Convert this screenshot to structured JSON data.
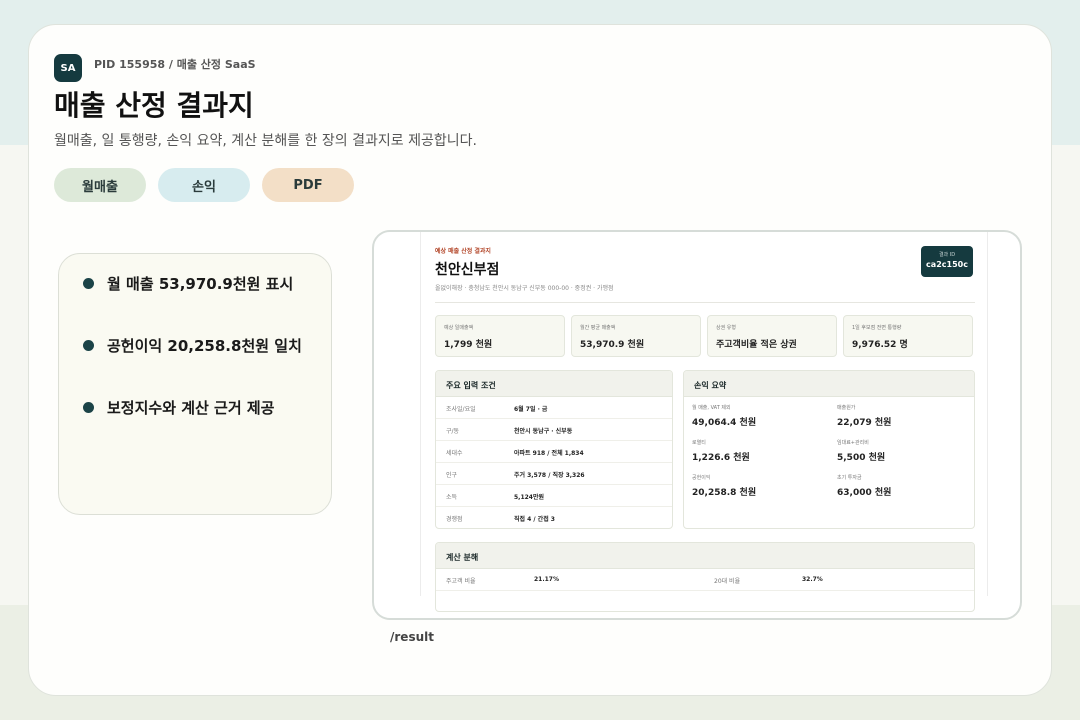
{
  "header": {
    "badge": "SA",
    "pid": "PID 155958 / 매출 산정 SaaS",
    "title": "매출 산정 결과지",
    "subtitle": "월매출, 일 통행량, 손익 요약, 계산 분해를 한 장의 결과지로 제공합니다."
  },
  "pills": [
    "월매출",
    "손익",
    "PDF"
  ],
  "bullets": [
    "월 매출 53,970.9천원 표시",
    "공헌이익 20,258.8천원 일치",
    "보정지수와 계산 근거 제공"
  ],
  "route": "/result",
  "shot": {
    "eyebrow": "예상 매출 산정 결과지",
    "store": "천안신부점",
    "meta": "올없이해장 · 충청남도 천안시 동남구 신부동 000-00 · 중정권 · 가맹점",
    "result_id_label": "결과 ID",
    "result_id": "ca2c150c",
    "stats": [
      {
        "label": "예상 일매출액",
        "value": "1,799 천원"
      },
      {
        "label": "월간 평균 매출액",
        "value": "53,970.9 천원"
      },
      {
        "label": "상권 유형",
        "value": "주고객비율 적은 상권"
      },
      {
        "label": "1일 후보점 전면 통행량",
        "value": "9,976.52 명"
      }
    ],
    "inputs": {
      "title": "주요 입력 조건",
      "rows": [
        {
          "k": "조사일/요일",
          "v": "6월 7일 · 금"
        },
        {
          "k": "구/동",
          "v": "천안시 동남구 · 신부동"
        },
        {
          "k": "세대수",
          "v": "아파트 918 / 전체 1,834"
        },
        {
          "k": "인구",
          "v": "주거 3,578 / 직장 3,326"
        },
        {
          "k": "소득",
          "v": "5,124만원"
        },
        {
          "k": "경쟁점",
          "v": "직접 4 / 간접 3"
        }
      ]
    },
    "pl": {
      "title": "손익 요약",
      "items": [
        {
          "k": "월 매출, VAT 제외",
          "v": "49,064.4 천원"
        },
        {
          "k": "매출원가",
          "v": "22,079 천원"
        },
        {
          "k": "로열티",
          "v": "1,226.6 천원"
        },
        {
          "k": "임대료+관리비",
          "v": "5,500 천원"
        },
        {
          "k": "공헌이익",
          "v": "20,258.8 천원"
        },
        {
          "k": "초기 투자금",
          "v": "63,000 천원"
        }
      ]
    },
    "calc": {
      "title": "계산 분해",
      "k1": "주고객 비율",
      "v1": "21.17%",
      "k2": "20대 비율",
      "v2": "32.7%"
    }
  }
}
